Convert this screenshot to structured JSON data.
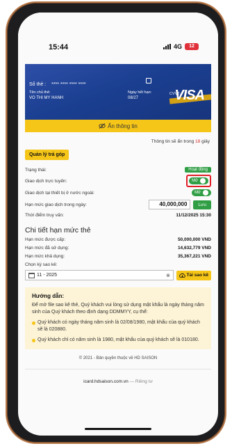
{
  "status_bar": {
    "time": "15:44",
    "network": "4G",
    "battery": "12"
  },
  "card": {
    "number_label": "Số thẻ :",
    "number_masked": "**** **** **** ****",
    "holder_label": "Tên chủ thẻ:",
    "holder_name": "VO THI MY HANH",
    "expiry_label": "Ngày hết hạn:",
    "expiry_value": "08/27",
    "cvv_label": "CVV2:",
    "brand": "VISA"
  },
  "show_info_label": "Ẩn thông tin",
  "timer": {
    "prefix": "Thông tin sẽ ẩn trong",
    "seconds": "18",
    "suffix": "giây"
  },
  "installment_button": "Quản lý trả góp",
  "settings": {
    "status_label": "Trạng thái:",
    "status_value": "Hoạt động",
    "online_label": "Giao dịch trực tuyến:",
    "online_value": "Mở",
    "foreign_label": "Giao dịch tại thiết bị ở nước ngoài:",
    "foreign_value": "Mở",
    "limit_label": "Hạn mức giao dịch trong ngày:",
    "limit_value": "40,000,000",
    "save_button": "Lưu",
    "query_time_label": "Thời điểm truy vấn:",
    "query_time_value": "11/12/2025 15:30"
  },
  "limit_details": {
    "title": "Chi tiết hạn mức thẻ",
    "granted_label": "Hạn mức được cấp:",
    "granted_value": "50,000,000 VND",
    "used_label": "Hạn mức đã sử dụng:",
    "used_value": "14,632,779 VND",
    "available_label": "Hạn mức khả dụng:",
    "available_value": "35,367,221 VND"
  },
  "statement": {
    "period_label": "Chọn kỳ sao kê:",
    "period_value": "11 - 2025",
    "download_button": "Tải sao kê"
  },
  "guide": {
    "title": "Hướng dẫn:",
    "intro": "Để mở file sao kê thẻ, Quý khách vui lòng sử dụng mật khẩu là ngày tháng năm sinh của Quý khách theo định dạng DDMMYY, cụ thể:",
    "bullet1": "Quý khách có ngày tháng năm sinh là 02/08/1980, mật khẩu của quý khách sẽ là 020880.",
    "bullet2": "Quý khách chỉ có năm sinh là 1980, mật khẩu của quý khách sẽ là 010180."
  },
  "copyright": "© 2021 - Bản quyền thuộc về HD SAISON",
  "url_bar": {
    "domain": "icard.hdsaison.com.vn",
    "suffix": "— Riêng tư"
  }
}
